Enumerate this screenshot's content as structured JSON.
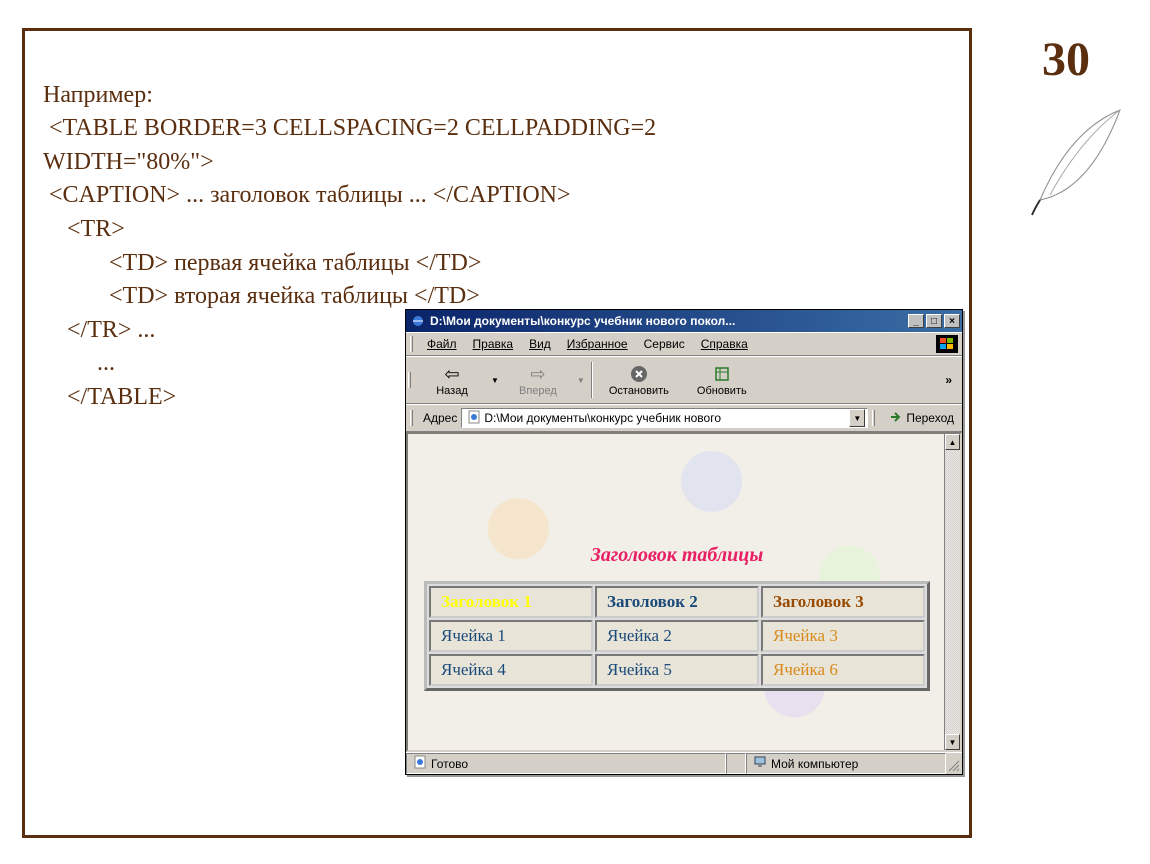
{
  "page_number": "30",
  "code": {
    "line1": "Например:",
    "line2": " <TABLE BORDER=3 CELLSPACING=2 CELLPADDING=2",
    "line3": "WIDTH=\"80%\">",
    "line4": " <CAPTION> ... заголовок таблицы ... </CAPTION>",
    "line5": "    <TR>",
    "line6": "           <TD> первая ячейка таблицы </TD>",
    "line7": "           <TD> вторая ячейка таблицы </TD>",
    "line8": "    </TR> ...",
    "line9": "         ...",
    "line10": "    </TABLE>"
  },
  "browser": {
    "title": "D:\\Мои документы\\конкурс учебник нового покол...",
    "menu": {
      "file": "Файл",
      "edit": "Правка",
      "view": "Вид",
      "favorites": "Избранное",
      "tools": "Сервис",
      "help": "Справка"
    },
    "toolbar": {
      "back": "Назад",
      "forward": "Вперед",
      "stop": "Остановить",
      "refresh": "Обновить"
    },
    "address_label": "Адрес",
    "address_value": "D:\\Мои документы\\конкурс учебник нового",
    "go_label": "Переход",
    "status_ready": "Готово",
    "status_zone": "Мой компьютер"
  },
  "table_demo": {
    "caption": "Заголовок таблицы",
    "headers": [
      "Заголовок 1",
      "Заголовок 2",
      "Заголовок 3"
    ],
    "row1": [
      "Ячейка 1",
      "Ячейка 2",
      "Ячейка 3"
    ],
    "row2": [
      "Ячейка 4",
      "Ячейка 5",
      "Ячейка 6"
    ]
  }
}
